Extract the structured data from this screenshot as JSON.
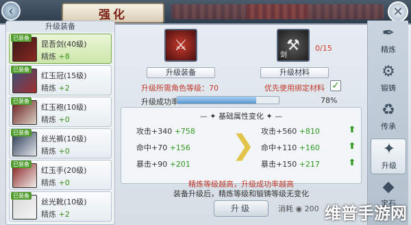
{
  "title": "强化",
  "left_panel": {
    "header": "升级装备",
    "items": [
      {
        "tag": "已装备",
        "name": "昆吾剑(40级)",
        "refine_label": "精炼",
        "refine_value": "+8",
        "selected": true
      },
      {
        "tag": "已装备",
        "name": "红玉冠(15级)",
        "refine_label": "精炼",
        "refine_value": "+2"
      },
      {
        "tag": "已装备",
        "name": "红玉袍(10级)",
        "refine_label": "精炼",
        "refine_value": "+0"
      },
      {
        "tag": "已装备",
        "name": "丝光裤(10级)",
        "refine_label": "精炼",
        "refine_value": "+0"
      },
      {
        "tag": "已装备",
        "name": "红玉手(20级)",
        "refine_label": "精炼",
        "refine_value": "+0"
      },
      {
        "tag": "已装备",
        "name": "丝光靴(10级)",
        "refine_label": "精炼",
        "refine_value": "+2"
      }
    ]
  },
  "center": {
    "equip_slot_label": "升级装备",
    "material_slot_label": "升级材料",
    "material_glyph": "剑",
    "material_count": "0/15",
    "required_level_text": "升级所需角色等级：",
    "required_level_value": "70",
    "bind_text": "优先使用绑定材料",
    "bind_checked": true,
    "success_rate_label": "升级成功率",
    "success_rate_value": "78%",
    "success_rate_fraction": 0.78,
    "attr_title": "基础属性变化",
    "attrs_before": [
      {
        "name": "攻击",
        "base": "+340",
        "inc": "+758"
      },
      {
        "name": "命中",
        "base": "+70",
        "inc": "+156"
      },
      {
        "name": "暴击",
        "base": "+90",
        "inc": "+201"
      }
    ],
    "attrs_after": [
      {
        "name": "攻击",
        "base": "+560",
        "inc": "+810"
      },
      {
        "name": "命中",
        "base": "+110",
        "inc": "+160"
      },
      {
        "name": "暴击",
        "base": "+150",
        "inc": "+217"
      }
    ],
    "note_red": "精炼等级越高，升级成功率越高",
    "note_black": "装备升级后，精炼等级和锻铸等级无变化",
    "upgrade_button": "升级",
    "cost_label": "消耗",
    "cost_value": "200"
  },
  "right_tabs": [
    {
      "label": "精炼",
      "icon": "refine-icon"
    },
    {
      "label": "锻铸",
      "icon": "forge-icon"
    },
    {
      "label": "传承",
      "icon": "inherit-icon"
    },
    {
      "label": "升级",
      "icon": "upgrade-icon",
      "active": true
    },
    {
      "label": "宝石",
      "icon": "gem-icon"
    }
  ],
  "watermark": "维普手游网"
}
